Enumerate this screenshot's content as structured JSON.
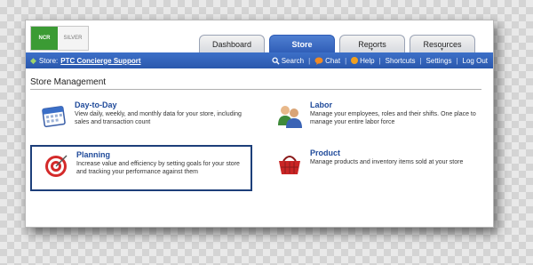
{
  "logo": {
    "brand_mark": "NCR",
    "tier": "SILVER"
  },
  "tabs": [
    {
      "label": "Dashboard",
      "active": false,
      "has_menu": false
    },
    {
      "label": "Store",
      "active": true,
      "has_menu": false
    },
    {
      "label": "Reports",
      "active": false,
      "has_menu": true
    },
    {
      "label": "Resources",
      "active": false,
      "has_menu": true
    }
  ],
  "navbar": {
    "store_label": "Store:",
    "store_name": "PTC Concierge Support",
    "links": {
      "search": "Search",
      "chat": "Chat",
      "help": "Help",
      "shortcuts": "Shortcuts",
      "settings": "Settings",
      "logout": "Log Out"
    },
    "separator": "|"
  },
  "section": {
    "title": "Store Management"
  },
  "cards": [
    {
      "id": "day-to-day",
      "title": "Day-to-Day",
      "description": "View daily, weekly, and monthly data for your store, including sales and transaction count",
      "icon": "calendar-icon",
      "selected": false
    },
    {
      "id": "labor",
      "title": "Labor",
      "description": "Manage your employees, roles and their shifts. One place to manage your entire labor force",
      "icon": "people-icon",
      "selected": false
    },
    {
      "id": "planning",
      "title": "Planning",
      "description": "Increase value and efficiency by setting goals for your store and tracking your performance against them",
      "icon": "target-icon",
      "selected": true
    },
    {
      "id": "product",
      "title": "Product",
      "description": "Manage products and inventory items sold at your store",
      "icon": "basket-icon",
      "selected": false
    }
  ],
  "colors": {
    "nav_blue": "#2d5bb5",
    "title_blue": "#1f4a9a",
    "brand_green": "#3b9b34"
  }
}
